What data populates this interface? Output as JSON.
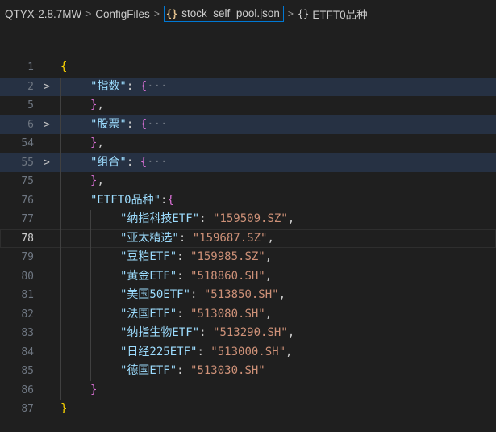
{
  "breadcrumb": {
    "folder1": "QTYX-2.8.7MW",
    "folder2": "ConfigFiles",
    "file_icon": "{}",
    "file": "stock_self_pool.json",
    "symbol_icon": "{}",
    "symbol": "ETFT0品种"
  },
  "lines": [
    {
      "n": "1",
      "indent": 0,
      "fold": "",
      "cls": "",
      "tokens": [
        {
          "c": "b1",
          "t": "{"
        }
      ]
    },
    {
      "n": "2",
      "indent": 1,
      "fold": ">",
      "cls": "folded-line",
      "tokens": [
        {
          "c": "k",
          "t": "\"指数\""
        },
        {
          "c": "p",
          "t": ": "
        },
        {
          "c": "b2",
          "t": "{"
        },
        {
          "c": "ell",
          "t": "···"
        }
      ]
    },
    {
      "n": "5",
      "indent": 1,
      "fold": "",
      "cls": "",
      "tokens": [
        {
          "c": "b2",
          "t": "}"
        },
        {
          "c": "p",
          "t": ","
        }
      ]
    },
    {
      "n": "6",
      "indent": 1,
      "fold": ">",
      "cls": "folded-line",
      "tokens": [
        {
          "c": "k",
          "t": "\"股票\""
        },
        {
          "c": "p",
          "t": ": "
        },
        {
          "c": "b2",
          "t": "{"
        },
        {
          "c": "ell",
          "t": "···"
        }
      ]
    },
    {
      "n": "54",
      "indent": 1,
      "fold": "",
      "cls": "",
      "tokens": [
        {
          "c": "b2",
          "t": "}"
        },
        {
          "c": "p",
          "t": ","
        }
      ]
    },
    {
      "n": "55",
      "indent": 1,
      "fold": ">",
      "cls": "folded-line",
      "tokens": [
        {
          "c": "k",
          "t": "\"组合\""
        },
        {
          "c": "p",
          "t": ": "
        },
        {
          "c": "b2",
          "t": "{"
        },
        {
          "c": "ell",
          "t": "···"
        }
      ]
    },
    {
      "n": "75",
      "indent": 1,
      "fold": "",
      "cls": "",
      "tokens": [
        {
          "c": "b2",
          "t": "}"
        },
        {
          "c": "p",
          "t": ","
        }
      ]
    },
    {
      "n": "76",
      "indent": 1,
      "fold": "",
      "cls": "",
      "tokens": [
        {
          "c": "k",
          "t": "\"ETFT0品种\""
        },
        {
          "c": "p",
          "t": ":"
        },
        {
          "c": "b2",
          "t": "{"
        }
      ]
    },
    {
      "n": "77",
      "indent": 2,
      "fold": "",
      "cls": "",
      "tokens": [
        {
          "c": "k",
          "t": "\"纳指科技ETF\""
        },
        {
          "c": "p",
          "t": ": "
        },
        {
          "c": "s",
          "t": "\"159509.SZ\""
        },
        {
          "c": "p",
          "t": ","
        }
      ]
    },
    {
      "n": "78",
      "indent": 2,
      "fold": "",
      "cls": "current",
      "tokens": [
        {
          "c": "k",
          "t": "\"亚太精选\""
        },
        {
          "c": "p",
          "t": ": "
        },
        {
          "c": "s",
          "t": "\"159687.SZ\""
        },
        {
          "c": "p",
          "t": ","
        }
      ]
    },
    {
      "n": "79",
      "indent": 2,
      "fold": "",
      "cls": "",
      "tokens": [
        {
          "c": "k",
          "t": "\"豆粕ETF\""
        },
        {
          "c": "p",
          "t": ": "
        },
        {
          "c": "s",
          "t": "\"159985.SZ\""
        },
        {
          "c": "p",
          "t": ","
        }
      ]
    },
    {
      "n": "80",
      "indent": 2,
      "fold": "",
      "cls": "",
      "tokens": [
        {
          "c": "k",
          "t": "\"黄金ETF\""
        },
        {
          "c": "p",
          "t": ": "
        },
        {
          "c": "s",
          "t": "\"518860.SH\""
        },
        {
          "c": "p",
          "t": ","
        }
      ]
    },
    {
      "n": "81",
      "indent": 2,
      "fold": "",
      "cls": "",
      "tokens": [
        {
          "c": "k",
          "t": "\"美国50ETF\""
        },
        {
          "c": "p",
          "t": ": "
        },
        {
          "c": "s",
          "t": "\"513850.SH\""
        },
        {
          "c": "p",
          "t": ","
        }
      ]
    },
    {
      "n": "82",
      "indent": 2,
      "fold": "",
      "cls": "",
      "tokens": [
        {
          "c": "k",
          "t": "\"法国ETF\""
        },
        {
          "c": "p",
          "t": ": "
        },
        {
          "c": "s",
          "t": "\"513080.SH\""
        },
        {
          "c": "p",
          "t": ","
        }
      ]
    },
    {
      "n": "83",
      "indent": 2,
      "fold": "",
      "cls": "",
      "tokens": [
        {
          "c": "k",
          "t": "\"纳指生物ETF\""
        },
        {
          "c": "p",
          "t": ": "
        },
        {
          "c": "s",
          "t": "\"513290.SH\""
        },
        {
          "c": "p",
          "t": ","
        }
      ]
    },
    {
      "n": "84",
      "indent": 2,
      "fold": "",
      "cls": "",
      "tokens": [
        {
          "c": "k",
          "t": "\"日经225ETF\""
        },
        {
          "c": "p",
          "t": ": "
        },
        {
          "c": "s",
          "t": "\"513000.SH\""
        },
        {
          "c": "p",
          "t": ","
        }
      ]
    },
    {
      "n": "85",
      "indent": 2,
      "fold": "",
      "cls": "",
      "tokens": [
        {
          "c": "k",
          "t": "\"德国ETF\""
        },
        {
          "c": "p",
          "t": ": "
        },
        {
          "c": "s",
          "t": "\"513030.SH\""
        }
      ]
    },
    {
      "n": "86",
      "indent": 1,
      "fold": "",
      "cls": "",
      "tokens": [
        {
          "c": "b2",
          "t": "}"
        }
      ]
    },
    {
      "n": "87",
      "indent": 0,
      "fold": "",
      "cls": "",
      "tokens": [
        {
          "c": "b1",
          "t": "}"
        }
      ]
    }
  ]
}
